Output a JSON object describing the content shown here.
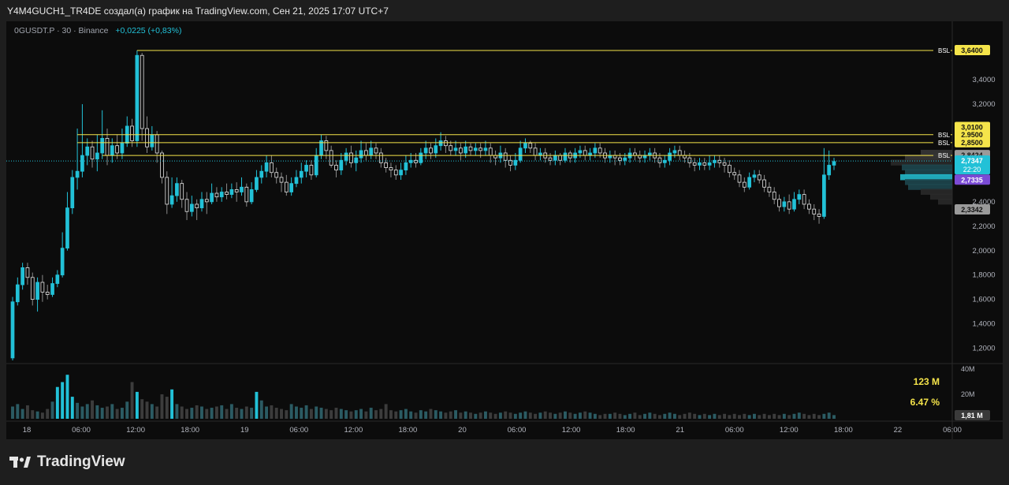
{
  "header": {
    "title": "Y4M4GUCH1_TR4DE создал(а) график на TradingView.com, Сен 21, 2025 17:07 UTC+7"
  },
  "legend": {
    "symbol": "0GUSDT.P · 30 · Binance",
    "change": "+0,0225 (+0,83%)"
  },
  "brand": {
    "name": "TradingView"
  },
  "colors": {
    "up": "#22c1d7",
    "down": "#e6e6e6",
    "bsl": "#f5e44a",
    "bg": "#0c0c0c"
  },
  "chart_data": {
    "type": "candlestick",
    "symbol": "0GUSDT.P",
    "timeframe": "30",
    "exchange": "Binance",
    "ylim": [
      1.1,
      3.75
    ],
    "y_ticks": [
      "3,4000",
      "3,2000",
      "2,4000",
      "2,2000",
      "2,0000",
      "1,8000",
      "1,6000",
      "1,4000",
      "1,2000"
    ],
    "x_ticks": [
      "18",
      "06:00",
      "12:00",
      "18:00",
      "19",
      "06:00",
      "12:00",
      "18:00",
      "20",
      "06:00",
      "12:00",
      "18:00",
      "21",
      "06:00",
      "12:00",
      "18:00",
      "22",
      "06:00"
    ],
    "candles": [
      [
        1.12,
        1.58,
        1.1,
        1.62
      ],
      [
        1.58,
        1.72,
        1.55,
        1.78
      ],
      [
        1.72,
        1.86,
        1.68,
        1.9
      ],
      [
        1.86,
        1.78,
        1.72,
        1.9
      ],
      [
        1.78,
        1.6,
        1.55,
        1.82
      ],
      [
        1.6,
        1.74,
        1.5,
        1.78
      ],
      [
        1.74,
        1.66,
        1.58,
        1.8
      ],
      [
        1.66,
        1.64,
        1.6,
        1.72
      ],
      [
        1.64,
        1.73,
        1.62,
        1.78
      ],
      [
        1.73,
        1.8,
        1.7,
        1.84
      ],
      [
        1.8,
        2.02,
        1.78,
        2.15
      ],
      [
        2.02,
        2.35,
        2.0,
        2.48
      ],
      [
        2.35,
        2.6,
        2.3,
        2.66
      ],
      [
        2.6,
        2.65,
        2.5,
        3.0
      ],
      [
        2.65,
        2.78,
        2.6,
        3.2
      ],
      [
        2.78,
        2.85,
        2.7,
        2.92
      ],
      [
        2.85,
        2.75,
        2.68,
        2.9
      ],
      [
        2.75,
        2.8,
        2.65,
        2.95
      ],
      [
        2.8,
        2.92,
        2.75,
        3.15
      ],
      [
        2.92,
        2.78,
        2.7,
        3.0
      ],
      [
        2.78,
        2.86,
        2.72,
        2.92
      ],
      [
        2.86,
        2.8,
        2.75,
        2.95
      ],
      [
        2.8,
        2.88,
        2.75,
        3.0
      ],
      [
        2.88,
        3.02,
        2.85,
        3.1
      ],
      [
        3.02,
        2.9,
        2.85,
        3.08
      ],
      [
        2.9,
        3.6,
        2.85,
        3.64
      ],
      [
        3.6,
        3.0,
        2.9,
        3.62
      ],
      [
        3.0,
        2.85,
        2.8,
        3.1
      ],
      [
        2.85,
        2.95,
        2.82,
        3.02
      ],
      [
        2.95,
        2.8,
        2.72,
        2.98
      ],
      [
        2.8,
        2.6,
        2.55,
        2.82
      ],
      [
        2.6,
        2.38,
        2.3,
        2.65
      ],
      [
        2.38,
        2.45,
        2.35,
        2.6
      ],
      [
        2.45,
        2.55,
        2.4,
        2.6
      ],
      [
        2.55,
        2.42,
        2.35,
        2.58
      ],
      [
        2.42,
        2.32,
        2.25,
        2.48
      ],
      [
        2.32,
        2.38,
        2.28,
        2.45
      ],
      [
        2.38,
        2.35,
        2.25,
        2.42
      ],
      [
        2.35,
        2.42,
        2.32,
        2.48
      ],
      [
        2.42,
        2.4,
        2.3,
        2.48
      ],
      [
        2.4,
        2.47,
        2.38,
        2.55
      ],
      [
        2.47,
        2.44,
        2.4,
        2.52
      ],
      [
        2.44,
        2.48,
        2.4,
        2.52
      ],
      [
        2.48,
        2.46,
        2.42,
        2.55
      ],
      [
        2.46,
        2.5,
        2.43,
        2.55
      ],
      [
        2.5,
        2.48,
        2.4,
        2.56
      ],
      [
        2.48,
        2.52,
        2.45,
        2.6
      ],
      [
        2.52,
        2.4,
        2.36,
        2.55
      ],
      [
        2.4,
        2.5,
        2.38,
        2.56
      ],
      [
        2.5,
        2.6,
        2.48,
        2.66
      ],
      [
        2.6,
        2.65,
        2.55,
        2.7
      ],
      [
        2.65,
        2.72,
        2.6,
        2.78
      ],
      [
        2.72,
        2.64,
        2.6,
        2.78
      ],
      [
        2.64,
        2.6,
        2.55,
        2.68
      ],
      [
        2.6,
        2.56,
        2.48,
        2.64
      ],
      [
        2.56,
        2.48,
        2.45,
        2.62
      ],
      [
        2.48,
        2.55,
        2.45,
        2.6
      ],
      [
        2.55,
        2.6,
        2.52,
        2.66
      ],
      [
        2.6,
        2.65,
        2.55,
        2.72
      ],
      [
        2.65,
        2.7,
        2.6,
        2.74
      ],
      [
        2.7,
        2.62,
        2.58,
        2.74
      ],
      [
        2.62,
        2.78,
        2.6,
        2.84
      ],
      [
        2.78,
        2.9,
        2.75,
        2.95
      ],
      [
        2.9,
        2.82,
        2.75,
        2.94
      ],
      [
        2.82,
        2.7,
        2.68,
        2.86
      ],
      [
        2.7,
        2.66,
        2.6,
        2.74
      ],
      [
        2.66,
        2.74,
        2.62,
        2.8
      ],
      [
        2.74,
        2.8,
        2.7,
        2.84
      ],
      [
        2.8,
        2.72,
        2.68,
        2.86
      ],
      [
        2.72,
        2.76,
        2.65,
        2.82
      ],
      [
        2.76,
        2.82,
        2.72,
        2.9
      ],
      [
        2.82,
        2.78,
        2.74,
        2.88
      ],
      [
        2.78,
        2.84,
        2.75,
        2.9
      ],
      [
        2.84,
        2.8,
        2.75,
        2.88
      ],
      [
        2.8,
        2.72,
        2.68,
        2.84
      ],
      [
        2.72,
        2.68,
        2.64,
        2.76
      ],
      [
        2.68,
        2.66,
        2.6,
        2.72
      ],
      [
        2.66,
        2.62,
        2.58,
        2.7
      ],
      [
        2.62,
        2.66,
        2.58,
        2.72
      ],
      [
        2.66,
        2.72,
        2.62,
        2.78
      ],
      [
        2.72,
        2.74,
        2.68,
        2.8
      ],
      [
        2.74,
        2.72,
        2.68,
        2.8
      ],
      [
        2.72,
        2.8,
        2.7,
        2.84
      ],
      [
        2.8,
        2.84,
        2.75,
        2.9
      ],
      [
        2.84,
        2.8,
        2.75,
        2.88
      ],
      [
        2.8,
        2.86,
        2.76,
        2.92
      ],
      [
        2.86,
        2.9,
        2.82,
        2.97
      ],
      [
        2.9,
        2.86,
        2.8,
        2.94
      ],
      [
        2.86,
        2.82,
        2.78,
        2.9
      ],
      [
        2.82,
        2.84,
        2.78,
        2.9
      ],
      [
        2.84,
        2.8,
        2.74,
        2.88
      ],
      [
        2.8,
        2.85,
        2.76,
        2.9
      ],
      [
        2.85,
        2.82,
        2.78,
        2.88
      ],
      [
        2.82,
        2.84,
        2.78,
        2.88
      ],
      [
        2.84,
        2.82,
        2.76,
        2.88
      ],
      [
        2.82,
        2.84,
        2.78,
        2.9
      ],
      [
        2.84,
        2.78,
        2.72,
        2.88
      ],
      [
        2.78,
        2.76,
        2.7,
        2.82
      ],
      [
        2.76,
        2.8,
        2.72,
        2.86
      ],
      [
        2.8,
        2.74,
        2.68,
        2.84
      ],
      [
        2.74,
        2.7,
        2.65,
        2.78
      ],
      [
        2.7,
        2.74,
        2.66,
        2.8
      ],
      [
        2.74,
        2.84,
        2.72,
        2.9
      ],
      [
        2.84,
        2.88,
        2.8,
        2.92
      ],
      [
        2.88,
        2.84,
        2.8,
        2.9
      ],
      [
        2.84,
        2.78,
        2.74,
        2.88
      ],
      [
        2.78,
        2.8,
        2.74,
        2.84
      ],
      [
        2.8,
        2.76,
        2.72,
        2.84
      ],
      [
        2.76,
        2.74,
        2.7,
        2.8
      ],
      [
        2.74,
        2.78,
        2.7,
        2.82
      ],
      [
        2.78,
        2.74,
        2.7,
        2.8
      ],
      [
        2.74,
        2.8,
        2.72,
        2.84
      ],
      [
        2.8,
        2.76,
        2.72,
        2.82
      ],
      [
        2.76,
        2.8,
        2.72,
        2.84
      ],
      [
        2.8,
        2.82,
        2.76,
        2.86
      ],
      [
        2.82,
        2.78,
        2.74,
        2.86
      ],
      [
        2.78,
        2.8,
        2.74,
        2.84
      ],
      [
        2.8,
        2.84,
        2.76,
        2.88
      ],
      [
        2.84,
        2.8,
        2.76,
        2.88
      ],
      [
        2.8,
        2.76,
        2.72,
        2.84
      ],
      [
        2.76,
        2.78,
        2.72,
        2.82
      ],
      [
        2.78,
        2.76,
        2.7,
        2.82
      ],
      [
        2.76,
        2.74,
        2.7,
        2.8
      ],
      [
        2.74,
        2.76,
        2.7,
        2.8
      ],
      [
        2.76,
        2.8,
        2.72,
        2.84
      ],
      [
        2.8,
        2.78,
        2.74,
        2.84
      ],
      [
        2.78,
        2.76,
        2.72,
        2.82
      ],
      [
        2.76,
        2.78,
        2.72,
        2.82
      ],
      [
        2.78,
        2.8,
        2.74,
        2.84
      ],
      [
        2.8,
        2.76,
        2.72,
        2.84
      ],
      [
        2.76,
        2.72,
        2.68,
        2.8
      ],
      [
        2.72,
        2.74,
        2.68,
        2.78
      ],
      [
        2.74,
        2.8,
        2.7,
        2.84
      ],
      [
        2.8,
        2.82,
        2.76,
        2.86
      ],
      [
        2.82,
        2.78,
        2.74,
        2.86
      ],
      [
        2.78,
        2.76,
        2.72,
        2.82
      ],
      [
        2.76,
        2.72,
        2.68,
        2.8
      ],
      [
        2.72,
        2.7,
        2.65,
        2.76
      ],
      [
        2.7,
        2.72,
        2.66,
        2.76
      ],
      [
        2.72,
        2.7,
        2.66,
        2.76
      ],
      [
        2.7,
        2.72,
        2.66,
        2.78
      ],
      [
        2.72,
        2.74,
        2.68,
        2.78
      ],
      [
        2.74,
        2.72,
        2.68,
        2.78
      ],
      [
        2.72,
        2.7,
        2.64,
        2.76
      ],
      [
        2.7,
        2.64,
        2.6,
        2.74
      ],
      [
        2.64,
        2.62,
        2.58,
        2.68
      ],
      [
        2.62,
        2.56,
        2.52,
        2.66
      ],
      [
        2.56,
        2.52,
        2.48,
        2.6
      ],
      [
        2.52,
        2.6,
        2.5,
        2.64
      ],
      [
        2.6,
        2.62,
        2.56,
        2.66
      ],
      [
        2.62,
        2.58,
        2.55,
        2.66
      ],
      [
        2.58,
        2.52,
        2.48,
        2.62
      ],
      [
        2.52,
        2.48,
        2.44,
        2.56
      ],
      [
        2.48,
        2.42,
        2.38,
        2.52
      ],
      [
        2.42,
        2.36,
        2.32,
        2.46
      ],
      [
        2.36,
        2.4,
        2.32,
        2.44
      ],
      [
        2.4,
        2.34,
        2.3,
        2.46
      ],
      [
        2.34,
        2.42,
        2.32,
        2.48
      ],
      [
        2.42,
        2.46,
        2.38,
        2.5
      ],
      [
        2.46,
        2.38,
        2.34,
        2.5
      ],
      [
        2.38,
        2.34,
        2.3,
        2.42
      ],
      [
        2.34,
        2.3,
        2.25,
        2.38
      ],
      [
        2.3,
        2.28,
        2.22,
        2.34
      ],
      [
        2.28,
        2.62,
        2.26,
        2.84
      ],
      [
        2.62,
        2.7,
        2.58,
        2.82
      ],
      [
        2.7,
        2.73,
        2.66,
        2.76
      ]
    ],
    "volume": {
      "ylim": [
        0,
        40
      ],
      "unit": "M",
      "ticks": [
        "40M",
        "20M"
      ],
      "last_label": "1,81 M",
      "values": [
        10,
        12,
        8,
        11,
        7,
        6,
        5,
        8,
        14,
        26,
        30,
        36,
        18,
        13,
        10,
        12,
        15,
        11,
        9,
        10,
        12,
        8,
        9,
        14,
        30,
        22,
        16,
        14,
        12,
        10,
        20,
        18,
        24,
        12,
        10,
        8,
        9,
        11,
        10,
        8,
        9,
        10,
        11,
        8,
        12,
        9,
        8,
        10,
        9,
        22,
        15,
        10,
        11,
        9,
        8,
        7,
        12,
        10,
        9,
        11,
        8,
        10,
        9,
        8,
        7,
        9,
        8,
        7,
        6,
        7,
        8,
        6,
        9,
        7,
        8,
        12,
        7,
        6,
        7,
        8,
        6,
        5,
        7,
        6,
        8,
        7,
        6,
        5,
        6,
        7,
        5,
        6,
        5,
        4,
        5,
        6,
        5,
        4,
        5,
        6,
        5,
        4,
        5,
        6,
        5,
        4,
        5,
        6,
        5,
        4,
        5,
        6,
        5,
        4,
        5,
        6,
        5,
        4,
        3,
        4,
        4,
        5,
        4,
        3,
        4,
        5,
        3,
        4,
        5,
        4,
        3,
        4,
        5,
        4,
        3,
        4,
        5,
        4,
        3,
        4,
        3,
        4,
        3,
        4,
        3,
        4,
        3,
        4,
        3,
        4,
        3,
        4,
        3,
        4,
        3,
        4,
        3,
        4,
        5,
        4,
        3,
        4,
        3,
        4,
        5,
        3,
        2,
        5,
        28,
        10,
        4
      ],
      "summary_volume": "123 M",
      "summary_percent": "6.47 %"
    },
    "levels": [
      {
        "label": "BSL",
        "price_label": "3,6400",
        "price": 3.64
      },
      {
        "label": "BSL",
        "price_label": "2,9500",
        "price": 2.95
      },
      {
        "label": "BSL",
        "price_label": "2,8500",
        "price": 2.885
      },
      {
        "label": "BSL",
        "price_label": "",
        "price": 2.78
      }
    ],
    "price_labels": [
      {
        "text": "3,0100",
        "kind": "yellow",
        "price": 3.01
      },
      {
        "text": "2,8424",
        "kind": "gray",
        "price": 2.78
      },
      {
        "text": "2,7347",
        "kind": "cyan",
        "price": 2.7347
      },
      {
        "text": "22:20",
        "kind": "cyan",
        "price": 2.7347
      },
      {
        "text": "2,7335",
        "kind": "purple",
        "price": 2.7335
      },
      {
        "text": "2,3342",
        "kind": "gray",
        "price": 2.3342
      }
    ],
    "current_price": 2.7347
  }
}
